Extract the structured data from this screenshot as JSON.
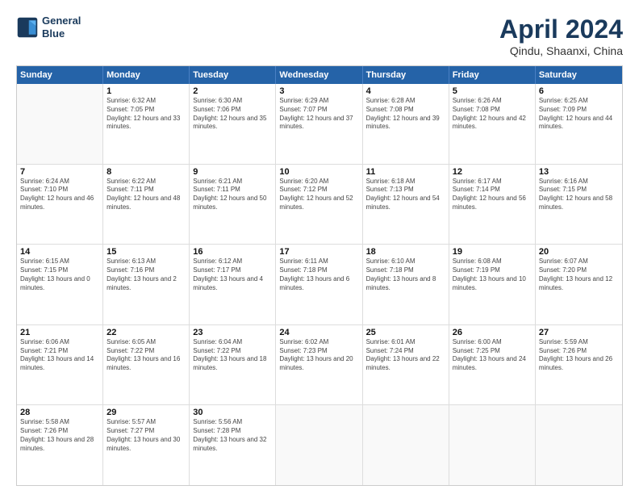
{
  "logo": {
    "line1": "General",
    "line2": "Blue"
  },
  "title": "April 2024",
  "subtitle": "Qindu, Shaanxi, China",
  "header_days": [
    "Sunday",
    "Monday",
    "Tuesday",
    "Wednesday",
    "Thursday",
    "Friday",
    "Saturday"
  ],
  "weeks": [
    [
      {
        "day": "",
        "sunrise": "",
        "sunset": "",
        "daylight": ""
      },
      {
        "day": "1",
        "sunrise": "Sunrise: 6:32 AM",
        "sunset": "Sunset: 7:05 PM",
        "daylight": "Daylight: 12 hours and 33 minutes."
      },
      {
        "day": "2",
        "sunrise": "Sunrise: 6:30 AM",
        "sunset": "Sunset: 7:06 PM",
        "daylight": "Daylight: 12 hours and 35 minutes."
      },
      {
        "day": "3",
        "sunrise": "Sunrise: 6:29 AM",
        "sunset": "Sunset: 7:07 PM",
        "daylight": "Daylight: 12 hours and 37 minutes."
      },
      {
        "day": "4",
        "sunrise": "Sunrise: 6:28 AM",
        "sunset": "Sunset: 7:08 PM",
        "daylight": "Daylight: 12 hours and 39 minutes."
      },
      {
        "day": "5",
        "sunrise": "Sunrise: 6:26 AM",
        "sunset": "Sunset: 7:08 PM",
        "daylight": "Daylight: 12 hours and 42 minutes."
      },
      {
        "day": "6",
        "sunrise": "Sunrise: 6:25 AM",
        "sunset": "Sunset: 7:09 PM",
        "daylight": "Daylight: 12 hours and 44 minutes."
      }
    ],
    [
      {
        "day": "7",
        "sunrise": "Sunrise: 6:24 AM",
        "sunset": "Sunset: 7:10 PM",
        "daylight": "Daylight: 12 hours and 46 minutes."
      },
      {
        "day": "8",
        "sunrise": "Sunrise: 6:22 AM",
        "sunset": "Sunset: 7:11 PM",
        "daylight": "Daylight: 12 hours and 48 minutes."
      },
      {
        "day": "9",
        "sunrise": "Sunrise: 6:21 AM",
        "sunset": "Sunset: 7:11 PM",
        "daylight": "Daylight: 12 hours and 50 minutes."
      },
      {
        "day": "10",
        "sunrise": "Sunrise: 6:20 AM",
        "sunset": "Sunset: 7:12 PM",
        "daylight": "Daylight: 12 hours and 52 minutes."
      },
      {
        "day": "11",
        "sunrise": "Sunrise: 6:18 AM",
        "sunset": "Sunset: 7:13 PM",
        "daylight": "Daylight: 12 hours and 54 minutes."
      },
      {
        "day": "12",
        "sunrise": "Sunrise: 6:17 AM",
        "sunset": "Sunset: 7:14 PM",
        "daylight": "Daylight: 12 hours and 56 minutes."
      },
      {
        "day": "13",
        "sunrise": "Sunrise: 6:16 AM",
        "sunset": "Sunset: 7:15 PM",
        "daylight": "Daylight: 12 hours and 58 minutes."
      }
    ],
    [
      {
        "day": "14",
        "sunrise": "Sunrise: 6:15 AM",
        "sunset": "Sunset: 7:15 PM",
        "daylight": "Daylight: 13 hours and 0 minutes."
      },
      {
        "day": "15",
        "sunrise": "Sunrise: 6:13 AM",
        "sunset": "Sunset: 7:16 PM",
        "daylight": "Daylight: 13 hours and 2 minutes."
      },
      {
        "day": "16",
        "sunrise": "Sunrise: 6:12 AM",
        "sunset": "Sunset: 7:17 PM",
        "daylight": "Daylight: 13 hours and 4 minutes."
      },
      {
        "day": "17",
        "sunrise": "Sunrise: 6:11 AM",
        "sunset": "Sunset: 7:18 PM",
        "daylight": "Daylight: 13 hours and 6 minutes."
      },
      {
        "day": "18",
        "sunrise": "Sunrise: 6:10 AM",
        "sunset": "Sunset: 7:18 PM",
        "daylight": "Daylight: 13 hours and 8 minutes."
      },
      {
        "day": "19",
        "sunrise": "Sunrise: 6:08 AM",
        "sunset": "Sunset: 7:19 PM",
        "daylight": "Daylight: 13 hours and 10 minutes."
      },
      {
        "day": "20",
        "sunrise": "Sunrise: 6:07 AM",
        "sunset": "Sunset: 7:20 PM",
        "daylight": "Daylight: 13 hours and 12 minutes."
      }
    ],
    [
      {
        "day": "21",
        "sunrise": "Sunrise: 6:06 AM",
        "sunset": "Sunset: 7:21 PM",
        "daylight": "Daylight: 13 hours and 14 minutes."
      },
      {
        "day": "22",
        "sunrise": "Sunrise: 6:05 AM",
        "sunset": "Sunset: 7:22 PM",
        "daylight": "Daylight: 13 hours and 16 minutes."
      },
      {
        "day": "23",
        "sunrise": "Sunrise: 6:04 AM",
        "sunset": "Sunset: 7:22 PM",
        "daylight": "Daylight: 13 hours and 18 minutes."
      },
      {
        "day": "24",
        "sunrise": "Sunrise: 6:02 AM",
        "sunset": "Sunset: 7:23 PM",
        "daylight": "Daylight: 13 hours and 20 minutes."
      },
      {
        "day": "25",
        "sunrise": "Sunrise: 6:01 AM",
        "sunset": "Sunset: 7:24 PM",
        "daylight": "Daylight: 13 hours and 22 minutes."
      },
      {
        "day": "26",
        "sunrise": "Sunrise: 6:00 AM",
        "sunset": "Sunset: 7:25 PM",
        "daylight": "Daylight: 13 hours and 24 minutes."
      },
      {
        "day": "27",
        "sunrise": "Sunrise: 5:59 AM",
        "sunset": "Sunset: 7:26 PM",
        "daylight": "Daylight: 13 hours and 26 minutes."
      }
    ],
    [
      {
        "day": "28",
        "sunrise": "Sunrise: 5:58 AM",
        "sunset": "Sunset: 7:26 PM",
        "daylight": "Daylight: 13 hours and 28 minutes."
      },
      {
        "day": "29",
        "sunrise": "Sunrise: 5:57 AM",
        "sunset": "Sunset: 7:27 PM",
        "daylight": "Daylight: 13 hours and 30 minutes."
      },
      {
        "day": "30",
        "sunrise": "Sunrise: 5:56 AM",
        "sunset": "Sunset: 7:28 PM",
        "daylight": "Daylight: 13 hours and 32 minutes."
      },
      {
        "day": "",
        "sunrise": "",
        "sunset": "",
        "daylight": ""
      },
      {
        "day": "",
        "sunrise": "",
        "sunset": "",
        "daylight": ""
      },
      {
        "day": "",
        "sunrise": "",
        "sunset": "",
        "daylight": ""
      },
      {
        "day": "",
        "sunrise": "",
        "sunset": "",
        "daylight": ""
      }
    ]
  ]
}
